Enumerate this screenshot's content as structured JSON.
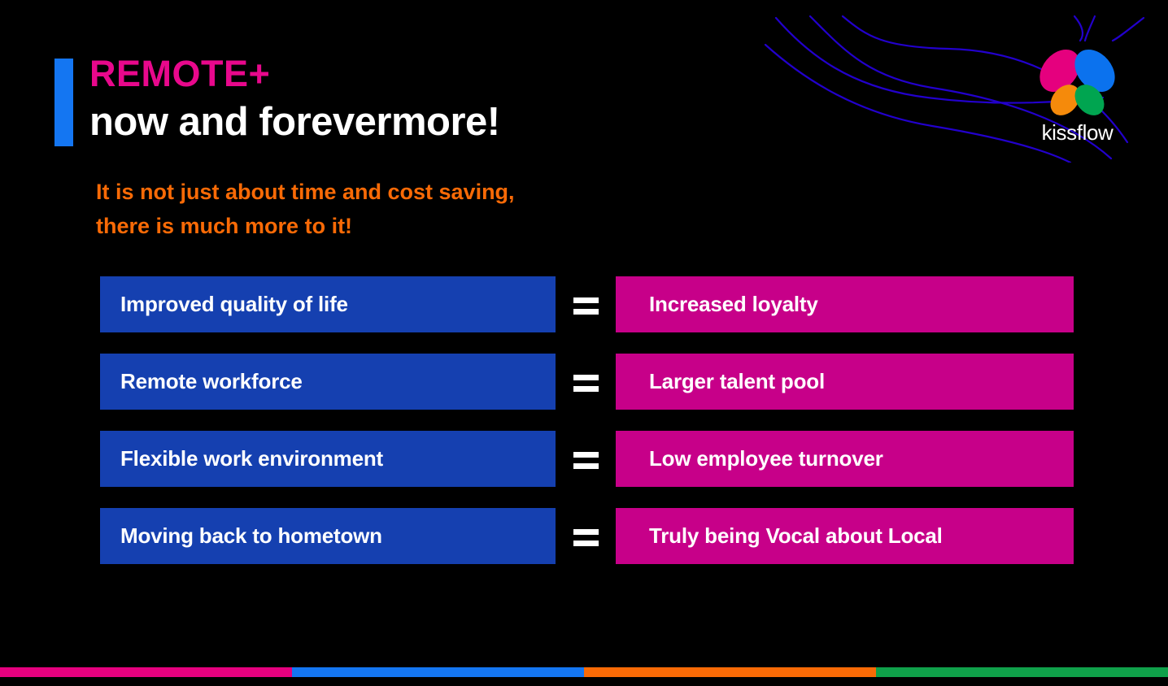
{
  "slide": {
    "background_color": "#000000",
    "title": {
      "line1": "REMOTE+",
      "line2": "now and forevermore!",
      "line1_color": "#E8088C",
      "line2_color": "#FFFFFF",
      "accent_bar_color": "#1476F2"
    },
    "subtitle": {
      "line1": "It is not just about time and cost saving,",
      "line2": "there is much more to it!",
      "color": "#F96A06"
    }
  },
  "logo": {
    "wordmark": "kissflow",
    "petals": [
      {
        "name": "magenta-petal",
        "color": "#E5007E"
      },
      {
        "name": "blue-petal",
        "color": "#0B72EE"
      },
      {
        "name": "orange-petal",
        "color": "#F58A0B"
      },
      {
        "name": "green-petal",
        "color": "#00A550"
      }
    ]
  },
  "equation_rows": [
    {
      "left": "Improved quality of life",
      "operator": "=",
      "right": "Increased loyalty"
    },
    {
      "left": "Remote workforce",
      "operator": "=",
      "right": "Larger talent pool"
    },
    {
      "left": "Flexible work environment",
      "operator": "=",
      "right": "Low employee turnover"
    },
    {
      "left": "Moving back to hometown",
      "operator": "=",
      "right": "Truly being Vocal about Local"
    }
  ],
  "colors": {
    "left_box": "#1540B0",
    "right_box": "#C70089",
    "equals": "#FFFFFF"
  },
  "bottom_strip": [
    {
      "name": "magenta",
      "color": "#E5007E"
    },
    {
      "name": "blue",
      "color": "#1476F2"
    },
    {
      "name": "orange",
      "color": "#F96A06"
    },
    {
      "name": "green",
      "color": "#0FA04A"
    }
  ]
}
